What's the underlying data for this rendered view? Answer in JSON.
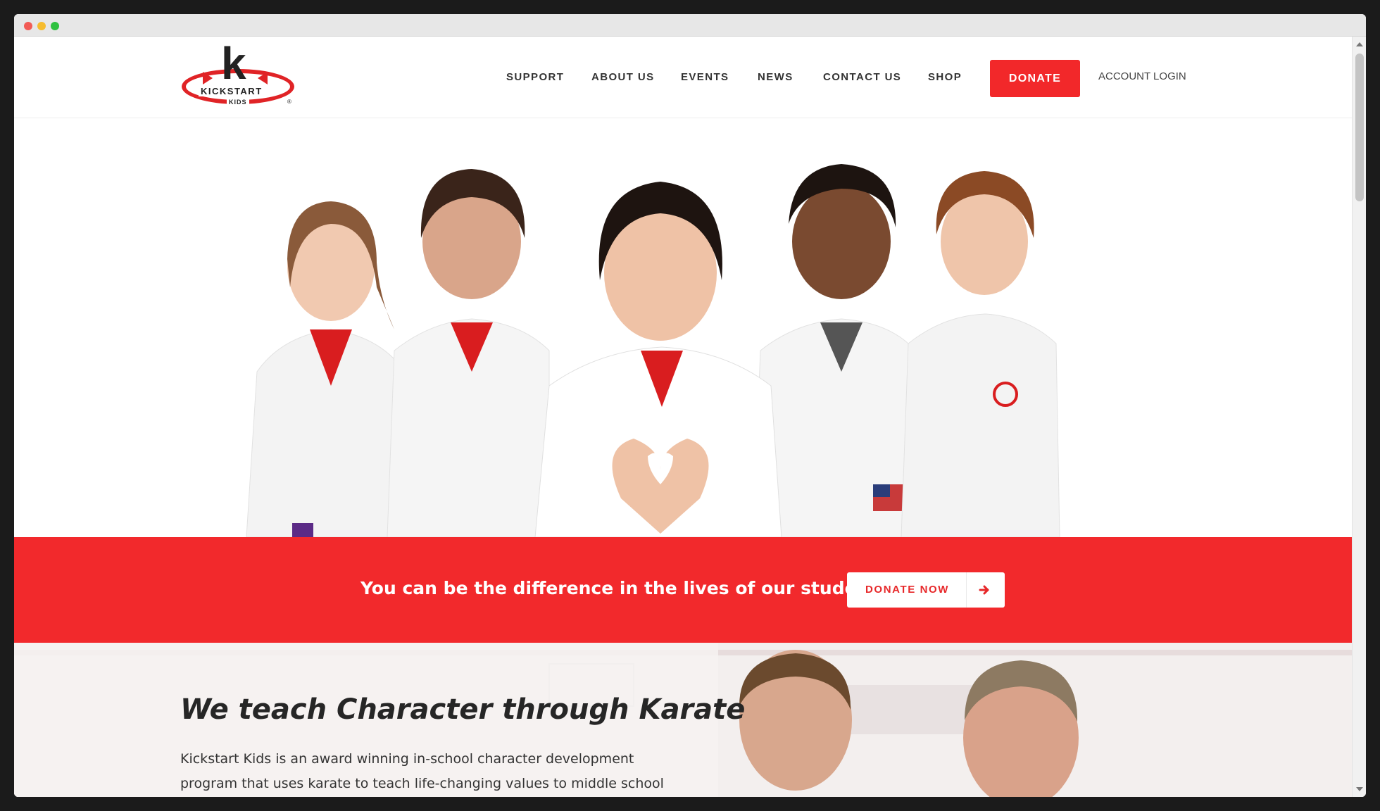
{
  "brand": {
    "logo_text": "KICKSTART",
    "logo_sub": "KIDS",
    "logo_mark": "k",
    "logo_reg": "®",
    "accent": "#f2282a"
  },
  "nav": {
    "items": [
      {
        "label": "SUPPORT"
      },
      {
        "label": "ABOUT US"
      },
      {
        "label": "EVENTS"
      },
      {
        "label": "NEWS"
      },
      {
        "label": "CONTACT US"
      },
      {
        "label": "SHOP"
      }
    ],
    "donate_label": "DONATE",
    "account_label": "ACCOUNT LOGIN"
  },
  "cta": {
    "text": "You can be the difference in the lives of our students.",
    "button_label": "DONATE NOW",
    "button_icon": "arrow-right-icon"
  },
  "about": {
    "title": "We teach Character through Karate",
    "body": "Kickstart Kids is an award winning in-school character development program that uses karate to teach life-changing values to middle school"
  }
}
